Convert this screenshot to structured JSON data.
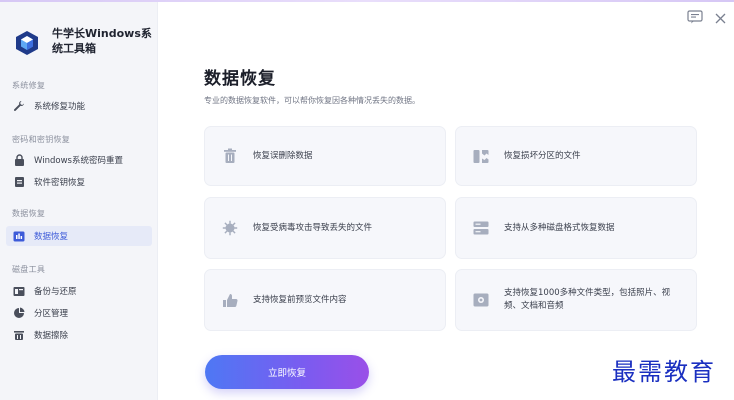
{
  "app": {
    "name": "牛学长Windows系统工具箱"
  },
  "sidebar": {
    "sections": [
      {
        "title": "系统修复",
        "items": [
          {
            "label": "系统修复功能",
            "icon": "wrench-icon"
          }
        ]
      },
      {
        "title": "密码和密钥恢复",
        "items": [
          {
            "label": "Windows系统密码重置",
            "icon": "lock-icon"
          },
          {
            "label": "软件密钥恢复",
            "icon": "key-doc-icon"
          }
        ]
      },
      {
        "title": "数据恢复",
        "items": [
          {
            "label": "数据恢复",
            "icon": "data-recovery-icon",
            "active": true
          }
        ]
      },
      {
        "title": "磁盘工具",
        "items": [
          {
            "label": "备份与还原",
            "icon": "backup-icon"
          },
          {
            "label": "分区管理",
            "icon": "pie-icon"
          },
          {
            "label": "数据擦除",
            "icon": "erase-icon"
          }
        ]
      }
    ]
  },
  "main": {
    "title": "数据恢复",
    "subtitle": "专业的数据恢复软件，可以帮你恢复因各种情况丢失的数据。",
    "cards": [
      {
        "text": "恢复误删除数据",
        "icon": "trash-icon"
      },
      {
        "text": "恢复损坏分区的文件",
        "icon": "partition-icon"
      },
      {
        "text": "恢复受病毒攻击导致丢失的文件",
        "icon": "virus-icon"
      },
      {
        "text": "支持从多种磁盘格式恢复数据",
        "icon": "disk-icon"
      },
      {
        "text": "支持恢复前预览文件内容",
        "icon": "preview-icon"
      },
      {
        "text": "支持恢复1000多种文件类型，包括照片、视频、文档和音频",
        "icon": "media-icon"
      }
    ],
    "cta_label": "立即恢复"
  },
  "watermark": "最需教育",
  "colors": {
    "accent": "#3d5bd9",
    "cta_start": "#4e78f4",
    "cta_end": "#9a4fe8",
    "sidebar_bg": "#f4f5f9",
    "card_bg": "#f6f7fb"
  }
}
